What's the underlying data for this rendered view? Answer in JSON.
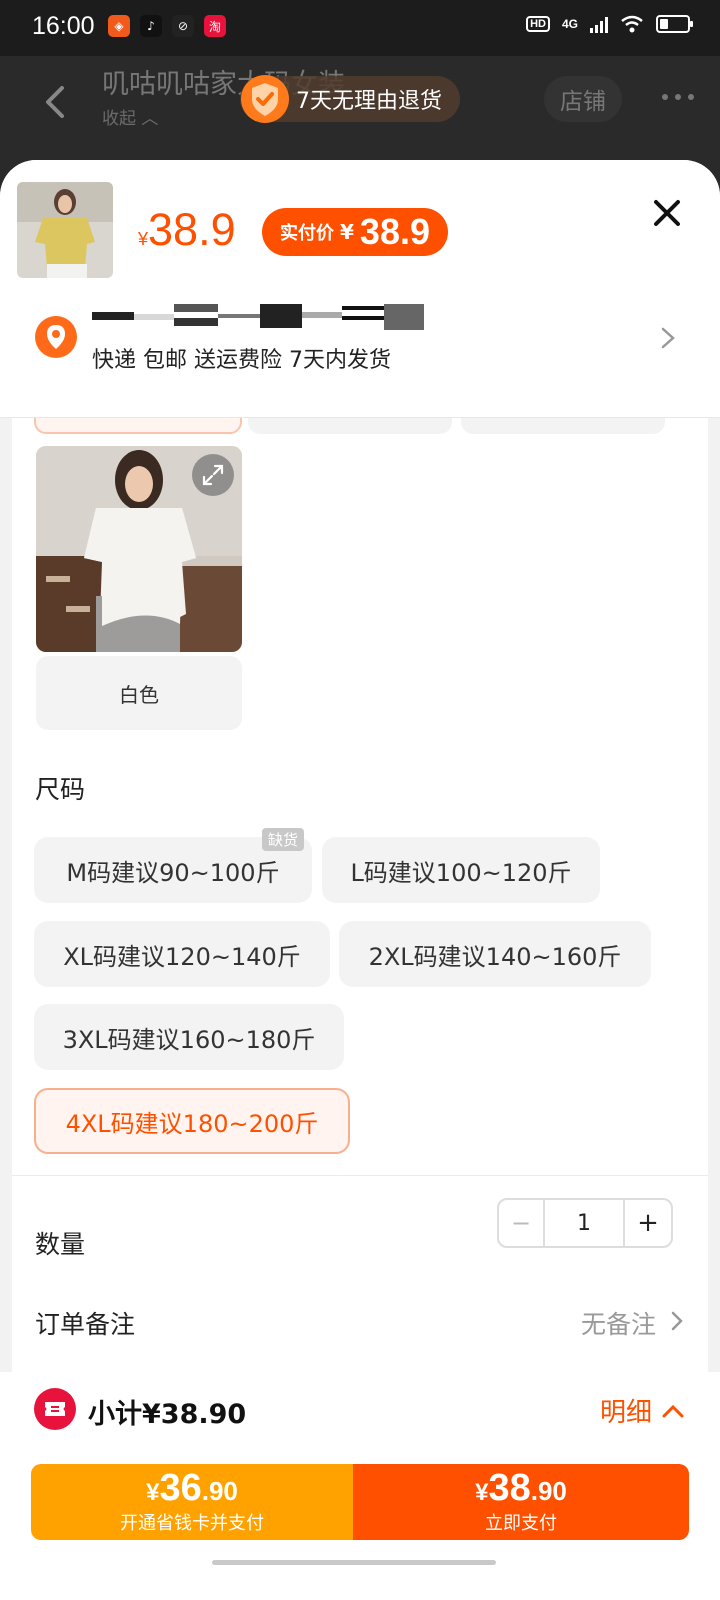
{
  "status_bar": {
    "time": "16:00",
    "network": "4G",
    "hd": "HD",
    "app_icons": [
      "meituan-app-icon",
      "douyin-app-icon",
      "browser-app-icon",
      "taobao-app-icon"
    ]
  },
  "shop": {
    "title": "叽咕叽咕家大码女装",
    "collapse": "收起 ︿",
    "shop_button": "店铺",
    "return_policy": "7天无理由退货"
  },
  "product": {
    "price_symbol": "¥",
    "price": "38.9",
    "final_label": "实付价",
    "final_symbol": "¥",
    "final_price": "38.9"
  },
  "delivery": {
    "text": "快递 包邮 送运费险 7天内发货"
  },
  "color": {
    "selected_label": "白色"
  },
  "size": {
    "heading": "尺码",
    "out_of_stock": "缺货",
    "options": [
      "M码建议90~100斤",
      "L码建议100~120斤",
      "XL码建议120~140斤",
      "2XL码建议140~160斤",
      "3XL码建议160~180斤",
      "4XL码建议180~200斤"
    ],
    "selected_index": 5
  },
  "quantity": {
    "label": "数量",
    "minus": "−",
    "value": "1",
    "plus": "+"
  },
  "note": {
    "label": "订单备注",
    "value": "无备注"
  },
  "summary": {
    "subtotal": "小计¥38.90",
    "detail": "明细"
  },
  "pay": {
    "card_symbol": "¥",
    "card_int": "36",
    "card_dec": ".90",
    "card_label": "开通省钱卡并支付",
    "now_symbol": "¥",
    "now_int": "38",
    "now_dec": ".90",
    "now_label": "立即支付"
  },
  "colors": {
    "accent": "#ff5000",
    "card_button": "#ffa200",
    "coupon": "#e8133c"
  }
}
